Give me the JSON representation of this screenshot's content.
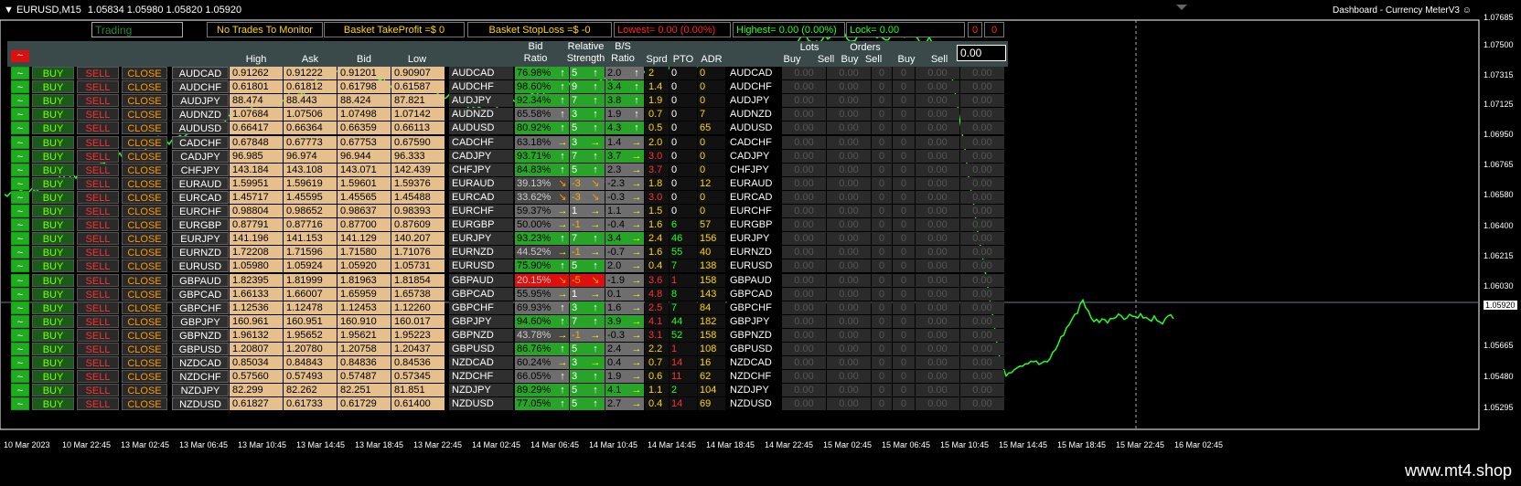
{
  "window": {
    "symbol_tf": "EURUSD,M15",
    "ohlc": "1.05834 1.05980 1.05820 1.05920",
    "indicator": "Dashboard - Currency MeterV3"
  },
  "header": {
    "trading": "Trading",
    "no_trades": "No Trades To Monitor",
    "take_profit": "Basket TakeProfit =$ 0",
    "stop_loss": "Basket StopLoss =$ -0",
    "lowest": "Lowest= 0.00 (0.00%)",
    "highest": "Highest= 0.00 (0.00%)",
    "lock": "Lock= 0.00",
    "zero1": "0",
    "zero2": "0",
    "input_value": "0.00"
  },
  "columns": {
    "high": "High",
    "ask": "Ask",
    "bid": "Bid",
    "low": "Low",
    "bid_ratio": "Bid\nRatio",
    "rel": "Relative\nStrength",
    "bs": "B/S\nRatio",
    "sprd": "Sprd",
    "pto": "PTO",
    "adr": "ADR",
    "lots": "Lots",
    "orders": "Orders",
    "buy": "Buy",
    "sell": "Sell"
  },
  "buttons": {
    "tilde": "~",
    "buy": "BUY",
    "sell": "SELL",
    "close": "CLOSE",
    "top_tilde": "~"
  },
  "rows": [
    {
      "s": "AUDCAD",
      "h": "0.91262",
      "a": "0.91222",
      "b": "0.91201",
      "l": "0.90907",
      "r": "76.98%",
      "ra": "up",
      "rc": "green",
      "rs": "5",
      "bs": "2.0",
      "ba": "up",
      "sp": "2",
      "pto": "0",
      "adr": "0"
    },
    {
      "s": "AUDCHF",
      "h": "0.61801",
      "a": "0.61812",
      "b": "0.61798",
      "l": "0.61587",
      "r": "98.60%",
      "ra": "up",
      "rc": "green",
      "rs": "9",
      "bs": "3.4",
      "ba": "up",
      "sp": "1.4",
      "pto": "0",
      "adr": "0"
    },
    {
      "s": "AUDJPY",
      "h": "88.474",
      "a": "88.443",
      "b": "88.424",
      "l": "87.821",
      "r": "92.34%",
      "ra": "up",
      "rc": "green",
      "rs": "7",
      "bs": "3.8",
      "ba": "up",
      "sp": "1.9",
      "pto": "0",
      "adr": "0"
    },
    {
      "s": "AUDNZD",
      "h": "1.07684",
      "a": "1.07506",
      "b": "1.07498",
      "l": "1.07142",
      "r": "65.58%",
      "ra": "up",
      "rc": "gray",
      "rs": "3",
      "bs": "1.9",
      "ba": "up",
      "sp": "0.7",
      "pto": "0",
      "adr": "7"
    },
    {
      "s": "AUDUSD",
      "h": "0.66417",
      "a": "0.66364",
      "b": "0.66359",
      "l": "0.66113",
      "r": "80.92%",
      "ra": "up",
      "rc": "green",
      "rs": "5",
      "bs": "4.3",
      "ba": "up",
      "sp": "0.5",
      "pto": "0",
      "adr": "65"
    },
    {
      "s": "CADCHF",
      "h": "0.67848",
      "a": "0.67773",
      "b": "0.67753",
      "l": "0.67590",
      "r": "63.18%",
      "ra": "right",
      "rc": "gray",
      "rs": "3",
      "bs": "1.4",
      "ba": "right",
      "sp": "2.0",
      "pto": "0",
      "adr": "0"
    },
    {
      "s": "CADJPY",
      "h": "96.985",
      "a": "96.974",
      "b": "96.944",
      "l": "96.333",
      "r": "93.71%",
      "ra": "up",
      "rc": "green",
      "rs": "7",
      "bs": "3.7",
      "ba": "right",
      "sp": "3.0",
      "pto": "0",
      "adr": "0"
    },
    {
      "s": "CHFJPY",
      "h": "143.184",
      "a": "143.108",
      "b": "143.071",
      "l": "142.439",
      "r": "84.83%",
      "ra": "up",
      "rc": "green",
      "rs": "5",
      "bs": "2.3",
      "ba": "right",
      "sp": "3.7",
      "pto": "0",
      "adr": "0"
    },
    {
      "s": "EURAUD",
      "h": "1.59951",
      "a": "1.59619",
      "b": "1.59601",
      "l": "1.59376",
      "r": "39.13%",
      "ra": "down",
      "rc": "grayd",
      "rs": "-3",
      "bs": "-2.3",
      "ba": "right",
      "sp": "1.8",
      "pto": "0",
      "adr": "12"
    },
    {
      "s": "EURCAD",
      "h": "1.45717",
      "a": "1.45595",
      "b": "1.45565",
      "l": "1.45488",
      "r": "33.62%",
      "ra": "down",
      "rc": "grayd",
      "rs": "-3",
      "bs": "-0.3",
      "ba": "right",
      "sp": "3.0",
      "pto": "0",
      "adr": "0"
    },
    {
      "s": "EURCHF",
      "h": "0.98804",
      "a": "0.98652",
      "b": "0.98637",
      "l": "0.98393",
      "r": "59.37%",
      "ra": "right",
      "rc": "gray",
      "rs": "1",
      "bs": "1.1",
      "ba": "right",
      "sp": "1.5",
      "pto": "0",
      "adr": "0"
    },
    {
      "s": "EURGBP",
      "h": "0.87791",
      "a": "0.87716",
      "b": "0.87700",
      "l": "0.87609",
      "r": "50.00%",
      "ra": "right",
      "rc": "gray",
      "rs": "-1",
      "bs": "-0.4",
      "ba": "right",
      "sp": "1.6",
      "pto": "6",
      "adr": "57"
    },
    {
      "s": "EURJPY",
      "h": "141.196",
      "a": "141.153",
      "b": "141.129",
      "l": "140.207",
      "r": "93.23%",
      "ra": "up",
      "rc": "green",
      "rs": "7",
      "bs": "3.4",
      "ba": "right",
      "sp": "2.4",
      "pto": "46",
      "adr": "156"
    },
    {
      "s": "EURNZD",
      "h": "1.72208",
      "a": "1.71596",
      "b": "1.71580",
      "l": "1.71076",
      "r": "44.52%",
      "ra": "right",
      "rc": "grayd",
      "rs": "-1",
      "bs": "-0.7",
      "ba": "right",
      "sp": "1.6",
      "pto": "55",
      "adr": "40"
    },
    {
      "s": "EURUSD",
      "h": "1.05980",
      "a": "1.05924",
      "b": "1.05920",
      "l": "1.05731",
      "r": "75.90%",
      "ra": "up",
      "rc": "green",
      "rs": "5",
      "bs": "2.0",
      "ba": "right",
      "sp": "0.4",
      "pto": "7",
      "adr": "138"
    },
    {
      "s": "GBPAUD",
      "h": "1.82395",
      "a": "1.81999",
      "b": "1.81963",
      "l": "1.81854",
      "r": "20.15%",
      "ra": "down",
      "rc": "red",
      "rs": "-5",
      "bs": "-1.9",
      "ba": "right",
      "sp": "3.6",
      "pto": "1",
      "adr": "158"
    },
    {
      "s": "GBPCAD",
      "h": "1.66133",
      "a": "1.66007",
      "b": "1.65959",
      "l": "1.65738",
      "r": "55.95%",
      "ra": "right",
      "rc": "gray",
      "rs": "1",
      "bs": "0.1",
      "ba": "right",
      "sp": "4.8",
      "pto": "8",
      "adr": "143"
    },
    {
      "s": "GBPCHF",
      "h": "1.12536",
      "a": "1.12478",
      "b": "1.12453",
      "l": "1.12260",
      "r": "69.93%",
      "ra": "up",
      "rc": "gray",
      "rs": "3",
      "bs": "1.6",
      "ba": "right",
      "sp": "2.5",
      "pto": "7",
      "adr": "84"
    },
    {
      "s": "GBPJPY",
      "h": "160.961",
      "a": "160.951",
      "b": "160.910",
      "l": "160.017",
      "r": "94.60%",
      "ra": "up",
      "rc": "green",
      "rs": "7",
      "bs": "3.9",
      "ba": "right",
      "sp": "4.1",
      "pto": "44",
      "adr": "182"
    },
    {
      "s": "GBPNZD",
      "h": "1.96132",
      "a": "1.95652",
      "b": "1.95621",
      "l": "1.95223",
      "r": "43.78%",
      "ra": "right",
      "rc": "grayd",
      "rs": "-1",
      "bs": "-0.3",
      "ba": "right",
      "sp": "3.1",
      "pto": "52",
      "adr": "158"
    },
    {
      "s": "GBPUSD",
      "h": "1.20807",
      "a": "1.20780",
      "b": "1.20758",
      "l": "1.20437",
      "r": "86.76%",
      "ra": "up",
      "rc": "green",
      "rs": "5",
      "bs": "2.4",
      "ba": "right",
      "sp": "2.2",
      "pto": "1",
      "adr": "108"
    },
    {
      "s": "NZDCAD",
      "h": "0.85034",
      "a": "0.84843",
      "b": "0.84836",
      "l": "0.84536",
      "r": "60.24%",
      "ra": "right",
      "rc": "gray",
      "rs": "3",
      "bs": "0.4",
      "ba": "right",
      "sp": "0.7",
      "pto": "14",
      "adr": "16"
    },
    {
      "s": "NZDCHF",
      "h": "0.57560",
      "a": "0.57493",
      "b": "0.57487",
      "l": "0.57345",
      "r": "66.05%",
      "ra": "up",
      "rc": "gray",
      "rs": "3",
      "bs": "1.9",
      "ba": "right",
      "sp": "0.6",
      "pto": "11",
      "adr": "62"
    },
    {
      "s": "NZDJPY",
      "h": "82.299",
      "a": "82.262",
      "b": "82.251",
      "l": "81.851",
      "r": "89.29%",
      "ra": "up",
      "rc": "green",
      "rs": "5",
      "bs": "4.1",
      "ba": "right",
      "sp": "1.1",
      "pto": "2",
      "adr": "104"
    },
    {
      "s": "NZDUSD",
      "h": "0.61827",
      "a": "0.61733",
      "b": "0.61729",
      "l": "0.61400",
      "r": "77.05%",
      "ra": "up",
      "rc": "green",
      "rs": "5",
      "bs": "2.7",
      "ba": "right",
      "sp": "0.4",
      "pto": "14",
      "adr": "69"
    }
  ],
  "lot_placeholder": "0.00",
  "lot_zero": "0",
  "price_axis": [
    "1.07685",
    "1.07500",
    "1.07315",
    "1.07125",
    "1.06950",
    "1.06765",
    "1.06580",
    "1.06400",
    "1.06215",
    "1.06030",
    "1.05920",
    "1.05665",
    "1.05480",
    "1.05295"
  ],
  "current_price": "1.05920",
  "time_axis": [
    "10 Mar 2023",
    "10 Mar 22:45",
    "13 Mar 02:45",
    "13 Mar 06:45",
    "13 Mar 10:45",
    "13 Mar 14:45",
    "13 Mar 18:45",
    "13 Mar 22:45",
    "14 Mar 02:45",
    "14 Mar 06:45",
    "14 Mar 10:45",
    "14 Mar 14:45",
    "14 Mar 18:45",
    "14 Mar 22:45",
    "15 Mar 02:45",
    "15 Mar 06:45",
    "15 Mar 10:45",
    "15 Mar 14:45",
    "15 Mar 18:45",
    "15 Mar 22:45",
    "16 Mar 02:45"
  ],
  "watermark": "www.mt4.shop",
  "colors": {
    "candle": "#22ff22",
    "bg": "#000000",
    "panel": "#3a4a4a",
    "price_line": "#a0a0a0"
  }
}
